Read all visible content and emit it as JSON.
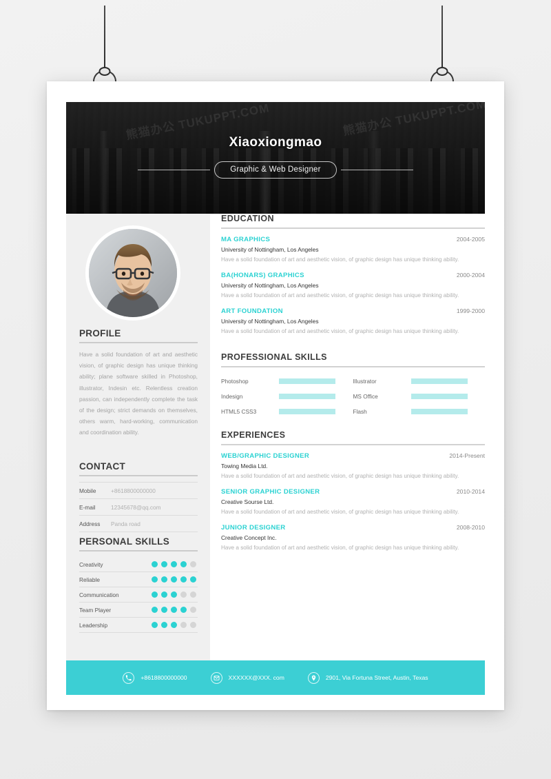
{
  "header": {
    "name": "Xiaoxiongmao",
    "job_title": "Graphic & Web Designer"
  },
  "sidebar": {
    "profile": {
      "heading": "PROFILE",
      "text": "Have a solid foundation of art and aesthetic vision, of graphic design has unique thinking ability; plane software skilled in Photoshop, illustrator, Indesin etc. Relentless creation passion, can independently complete the task of the design; strict demands on themselves, others warm, hard-working, communication and coordination ability."
    },
    "contact": {
      "heading": "CONTACT",
      "rows": [
        {
          "label": "Mobile",
          "value": "+8618800000000"
        },
        {
          "label": "E-mail",
          "value": "12345678@qq.com"
        },
        {
          "label": "Address",
          "value": "Panda road"
        }
      ]
    },
    "personal_skills": {
      "heading": "PERSONAL SKILLS",
      "max_dots": 5,
      "rows": [
        {
          "label": "Creativity",
          "rating": 4
        },
        {
          "label": "Reliable",
          "rating": 5
        },
        {
          "label": "Communication",
          "rating": 3
        },
        {
          "label": "Team Player",
          "rating": 4
        },
        {
          "label": "Leadership",
          "rating": 3
        }
      ]
    }
  },
  "main": {
    "education": {
      "heading": "EDUCATION",
      "entries": [
        {
          "title": "MA GRAPHICS",
          "date": "2004-2005",
          "subtitle": "University of Nottingham, Los Angeles",
          "description": "Have a solid foundation of art and aesthetic vision, of graphic design has unique thinking ability."
        },
        {
          "title": "BA(HONARS) GRAPHICS",
          "date": "2000-2004",
          "subtitle": "University of Nottingham, Los Angeles",
          "description": "Have a solid foundation of art and aesthetic vision, of graphic design has unique thinking ability."
        },
        {
          "title": "ART FOUNDATION",
          "date": "1999-2000",
          "subtitle": "University of Nottingham, Los Angeles",
          "description": "Have a solid foundation of art and aesthetic vision, of graphic design has unique thinking ability."
        }
      ]
    },
    "professional_skills": {
      "heading": "PROFESSIONAL SKILLS",
      "items": [
        {
          "label": "Photoshop",
          "value": 70
        },
        {
          "label": "Illustrator",
          "value": 72
        },
        {
          "label": "Indesign",
          "value": 78
        },
        {
          "label": "MS Office",
          "value": 75
        },
        {
          "label": "HTML5 CSS3",
          "value": 72
        },
        {
          "label": "Flash",
          "value": 68
        }
      ]
    },
    "experiences": {
      "heading": "EXPERIENCES",
      "entries": [
        {
          "title": "WEB/GRAPHIC DESIGNER",
          "date": "2014-Present",
          "subtitle": "Towing Media Ltd.",
          "description": "Have a solid foundation of art and aesthetic vision, of graphic design has unique thinking ability."
        },
        {
          "title": "SENIOR GRAPHIC DESIGNER",
          "date": "2010-2014",
          "subtitle": "Creative Sourse Ltd.",
          "description": "Have a solid foundation of art and aesthetic vision, of graphic design has unique thinking ability."
        },
        {
          "title": "JUNIOR DESIGNER",
          "date": "2008-2010",
          "subtitle": "Creative Concept Inc.",
          "description": "Have a solid foundation of art and aesthetic vision, of graphic design has unique thinking ability."
        }
      ]
    }
  },
  "footer": {
    "items": [
      {
        "icon": "phone-icon",
        "text": "+8618800000000"
      },
      {
        "icon": "mail-icon",
        "text": "XXXXXX@XXX. com"
      },
      {
        "icon": "location-pin-icon",
        "text": "2901, Via Fortuna Street, Austin, Texas"
      }
    ]
  },
  "watermark": {
    "text": "熊猫办公 TUKUPPT.COM"
  },
  "colors": {
    "accent": "#2BD2D2",
    "footer_bg": "#3CCFD4",
    "sidebar_bg": "#F0F0F0",
    "banner_bg": "#1A1A1A"
  }
}
